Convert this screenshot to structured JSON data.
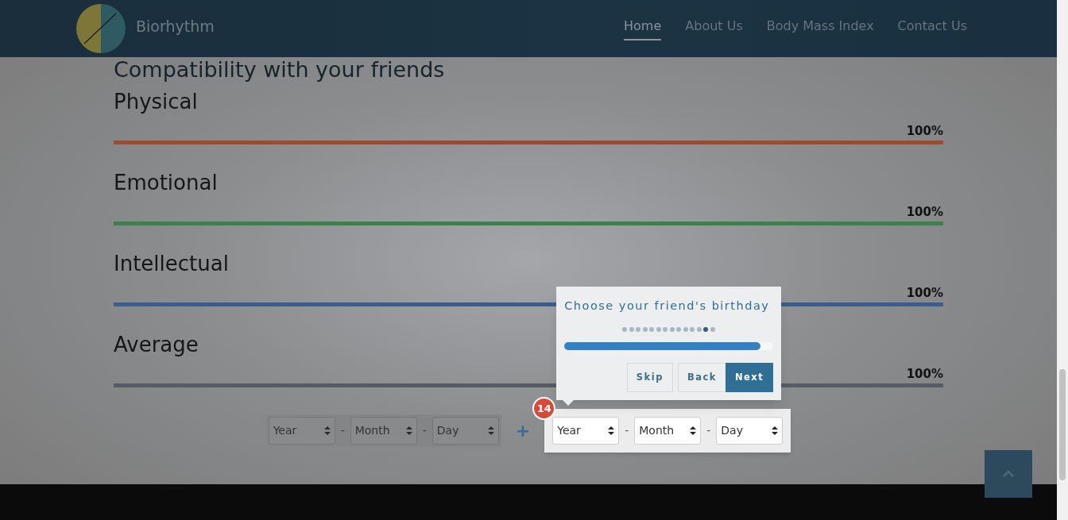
{
  "header": {
    "brand": "Biorhythm",
    "nav": [
      {
        "label": "Home",
        "selected": true
      },
      {
        "label": "About Us",
        "selected": false
      },
      {
        "label": "Body Mass Index",
        "selected": false
      },
      {
        "label": "Contact Us",
        "selected": false
      }
    ]
  },
  "heading": "Compatibility with your friends",
  "cycles": [
    {
      "name": "Physical",
      "reading": "100%",
      "level": 1,
      "color": "#9c4a33"
    },
    {
      "name": "Emotional",
      "reading": "100%",
      "level": 1,
      "color": "#3f7f4c"
    },
    {
      "name": "Intellectual",
      "reading": "100%",
      "level": 1,
      "color": "#3b5d8e"
    },
    {
      "name": "Average",
      "reading": "100%",
      "level": 1,
      "color": "#555c66"
    }
  ],
  "birthdays": [
    {
      "fields": [
        "Year",
        "Month",
        "Day"
      ],
      "separators": [
        "-",
        "-"
      ],
      "highlighted": false
    },
    {
      "fields": [
        "Year",
        "Month",
        "Day"
      ],
      "separators": [
        "-",
        "-"
      ],
      "highlighted": true
    }
  ],
  "add_symbol": "+",
  "tour": {
    "title": "Choose your friend's birthday",
    "step_badge": "14",
    "level": 0.94,
    "steps": [
      {
        "selected": false
      },
      {
        "selected": false
      },
      {
        "selected": false
      },
      {
        "selected": false
      },
      {
        "selected": false
      },
      {
        "selected": false
      },
      {
        "selected": false
      },
      {
        "selected": false
      },
      {
        "selected": false
      },
      {
        "selected": false
      },
      {
        "selected": false
      },
      {
        "selected": false
      },
      {
        "selected": true
      },
      {
        "selected": false
      }
    ],
    "buttons": [
      {
        "label": "Skip",
        "kind": "skip"
      },
      {
        "label": "Back",
        "kind": "back"
      },
      {
        "label": "Next",
        "kind": "next"
      }
    ]
  }
}
